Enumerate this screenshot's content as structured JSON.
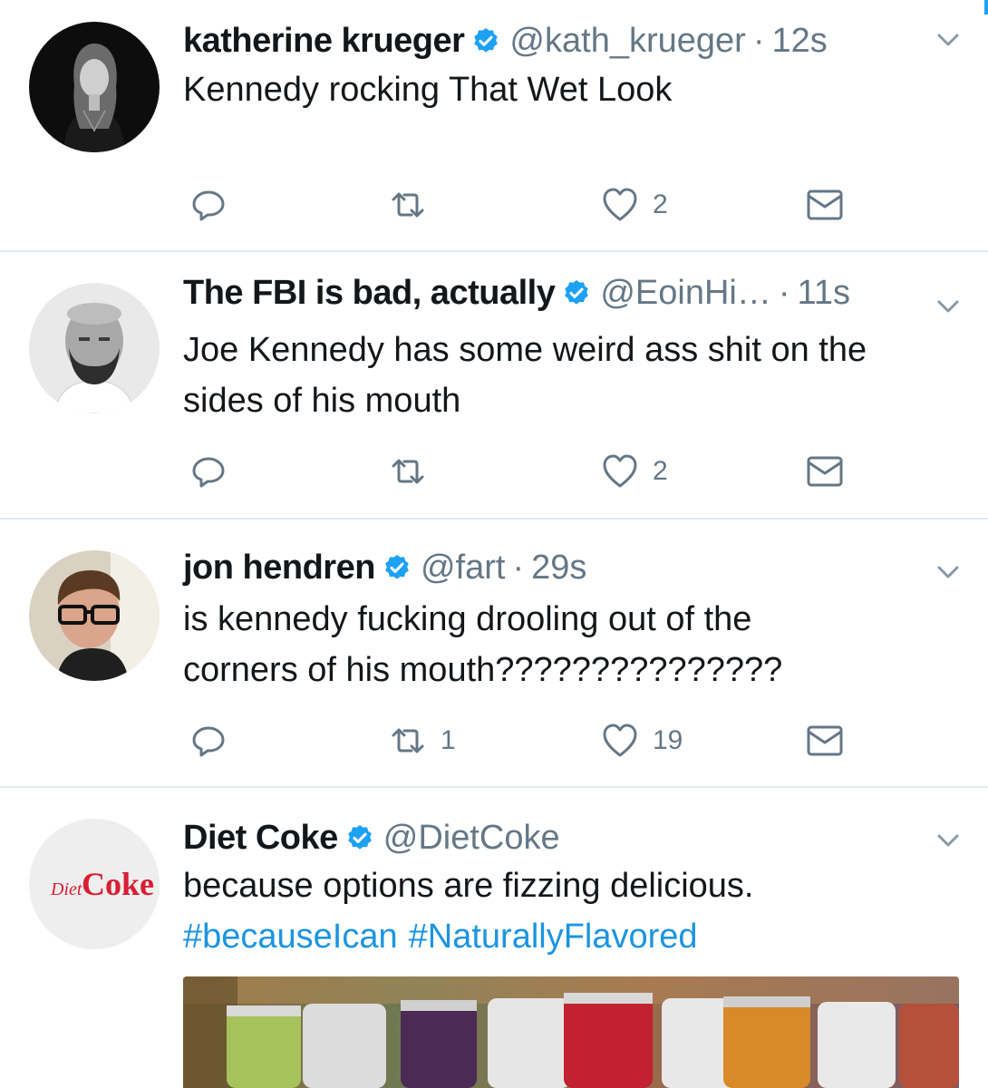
{
  "tweets": [
    {
      "name": "katherine krueger",
      "handle": "@kath_krueger",
      "time": "12s",
      "text_lines": [
        "Kennedy rocking That Wet Look"
      ],
      "retweets": "",
      "likes": "2"
    },
    {
      "name": "The FBI is bad, actually",
      "handle": "@EoinHi…",
      "time": "11s",
      "text_lines": [
        "Joe Kennedy has some weird ass shit on the",
        "sides of his mouth"
      ],
      "retweets": "",
      "likes": "2"
    },
    {
      "name": "jon hendren",
      "handle": "@fart",
      "time": "29s",
      "text_lines": [
        "is kennedy fucking drooling out of the",
        "corners of his mouth???????????????"
      ],
      "retweets": "1",
      "likes": "19"
    },
    {
      "name": "Diet Coke",
      "handle": "@DietCoke",
      "time": "",
      "text_lines": [
        "because options are fizzing delicious."
      ],
      "hashtags": [
        "#becauseIcan",
        "#NaturallyFlavored"
      ],
      "avatar_text": {
        "small": "Diet",
        "big": "Coke"
      }
    }
  ],
  "separator": "·",
  "icons": {
    "reply": "reply-icon",
    "retweet": "retweet-icon",
    "like": "heart-icon",
    "dm": "envelope-icon",
    "verified": "verified-badge-icon",
    "menu": "chevron-down-icon"
  },
  "colors": {
    "text": "#14171a",
    "secondary": "#657786",
    "link": "#1b95e0",
    "verified": "#1da1f2",
    "divider": "#e1e8ed",
    "coke_red": "#d81e32"
  }
}
